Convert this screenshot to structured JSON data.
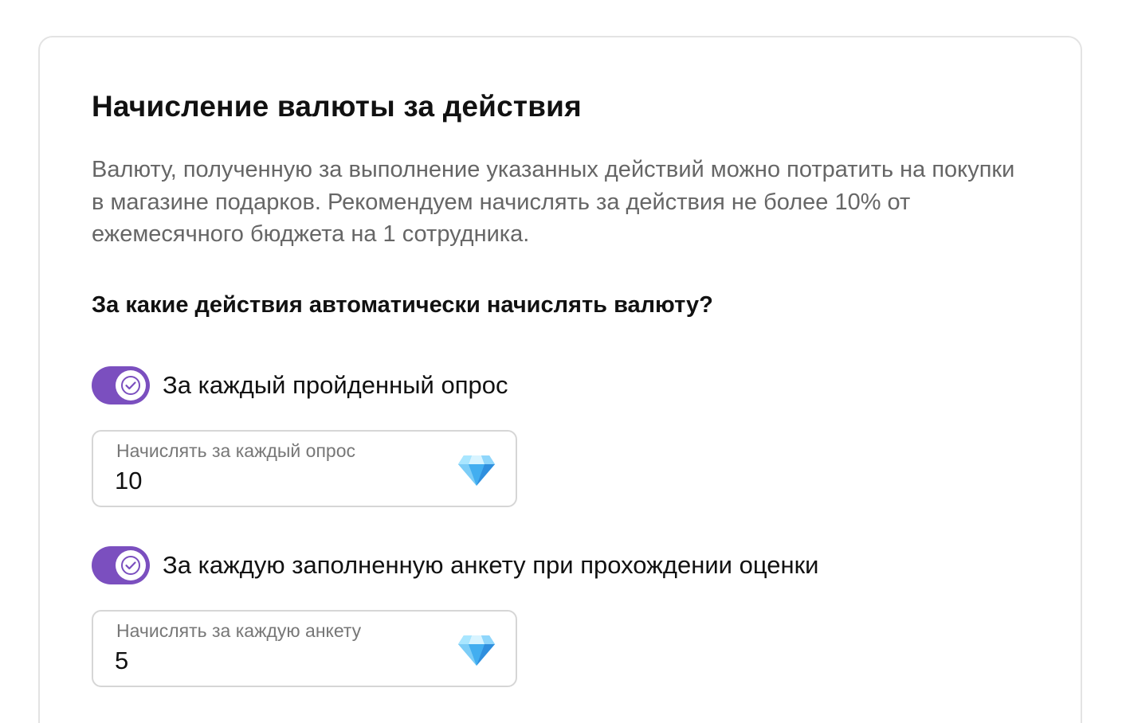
{
  "section": {
    "title": "Начисление валюты за действия",
    "description": "Валюту, полученную за выполнение указанных действий можно потратить на покупки в магазине подарков. Рекомендуем начислять за действия не более 10% от ежемесячного бюджета на 1 сотрудника.",
    "question": "За какие действия автоматически начислять валюту?"
  },
  "actions": [
    {
      "toggle_on": true,
      "label": "За каждый пройденный опрос",
      "field_label": "Начислять за каждый опрос",
      "field_value": "10",
      "field_icon": "diamond-icon"
    },
    {
      "toggle_on": true,
      "label": "За каждую заполненную анкету при прохождении оценки",
      "field_label": "Начислять за каждую анкету",
      "field_value": "5",
      "field_icon": "diamond-icon"
    }
  ],
  "colors": {
    "toggle_on": "#7b4fbf",
    "title_text": "#111111",
    "muted_text": "#666666",
    "gem_light": "#8fdcff",
    "gem_dark": "#2f9be6"
  }
}
